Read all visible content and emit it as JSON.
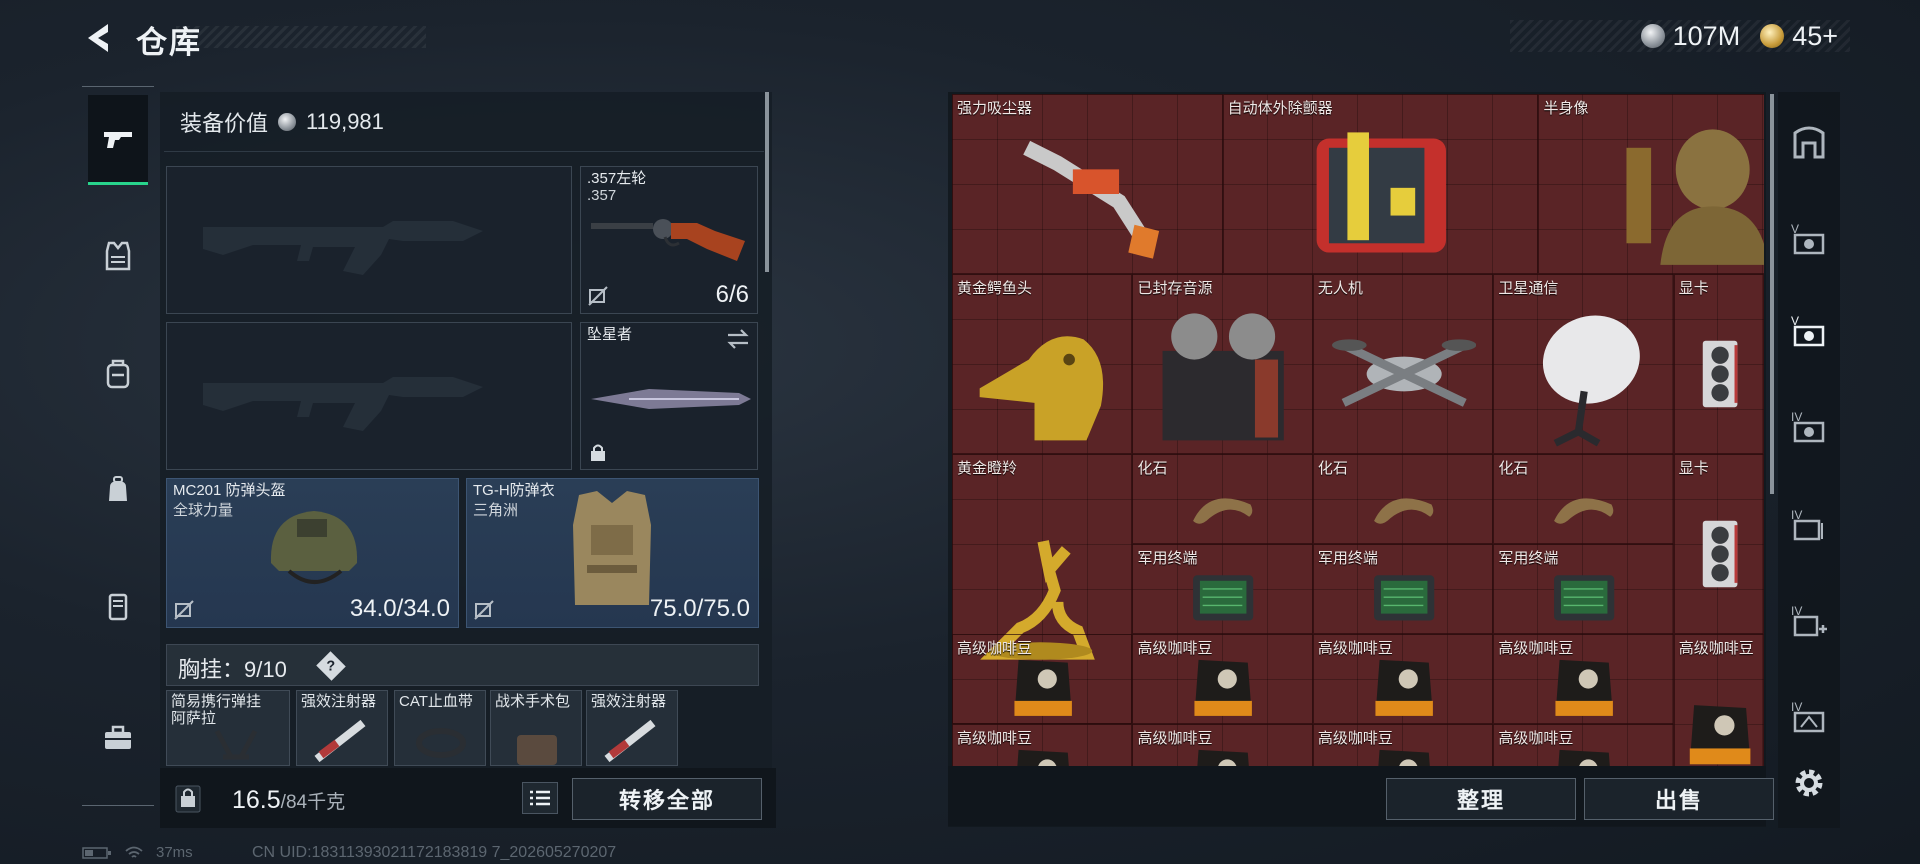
{
  "header": {
    "title": "仓库",
    "currencies": [
      {
        "icon": "silver-coin-icon",
        "value": "107M"
      },
      {
        "icon": "gold-coin-icon",
        "value": "45+"
      }
    ]
  },
  "left_rail": {
    "tabs": [
      {
        "icon": "gun-icon",
        "active": true
      },
      {
        "icon": "armor-vest-icon",
        "active": false
      },
      {
        "icon": "backpack-icon",
        "active": false
      },
      {
        "icon": "bag-icon",
        "active": false
      },
      {
        "icon": "container-icon",
        "active": false
      },
      {
        "icon": "toolbox-icon",
        "active": false
      }
    ]
  },
  "equipment": {
    "value_label": "装备价值",
    "value": "119,981",
    "sidearm": {
      "name": ".357左轮",
      "caliber": ".357",
      "ammo": "6/6"
    },
    "melee": {
      "name": "坠星者"
    },
    "helmet": {
      "name": "MC201 防弹头盔",
      "faction": "全球力量",
      "durability": "34.0/34.0"
    },
    "armor": {
      "name": "TG-H防弹衣",
      "faction": "三角洲",
      "durability": "75.0/75.0"
    },
    "chest_rig": {
      "label": "胸挂：",
      "capacity": "9/10",
      "help": "?"
    },
    "rig_items": [
      {
        "name": "简易携行弹挂",
        "sub": "阿萨拉"
      },
      {
        "name": "强效注射器",
        "sub": ""
      },
      {
        "name": "CAT止血带",
        "sub": ""
      },
      {
        "name": "战术手术包",
        "sub": ""
      },
      {
        "name": "强效注射器",
        "sub": ""
      }
    ]
  },
  "weight": {
    "current": "16.5",
    "max": "/84千克"
  },
  "buttons": {
    "transfer_all": "转移全部",
    "sort": "整理",
    "sell": "出售"
  },
  "status": {
    "ping": "37ms",
    "uid": "CN UID:18311393021172183819 7_202605270207"
  },
  "stash": {
    "items": [
      {
        "name": "强力吸尘器",
        "icon": "vacuum-icon"
      },
      {
        "name": "自动体外除颤器",
        "icon": "defibrillator-icon"
      },
      {
        "name": "半身像",
        "icon": "bust-icon"
      },
      {
        "name": "黄金鳄鱼头",
        "icon": "gold-croc-head-icon"
      },
      {
        "name": "已封存音源",
        "icon": "tape-recorder-icon"
      },
      {
        "name": "无人机",
        "icon": "drone-icon"
      },
      {
        "name": "卫星通信",
        "icon": "satellite-dish-icon"
      },
      {
        "name": "显卡",
        "icon": "gpu-icon"
      },
      {
        "name": "黄金瞪羚",
        "icon": "gold-gazelle-icon"
      },
      {
        "name": "化石",
        "icon": "fossil-icon"
      },
      {
        "name": "化石",
        "icon": "fossil-icon"
      },
      {
        "name": "化石",
        "icon": "fossil-icon"
      },
      {
        "name": "显卡",
        "icon": "gpu-icon"
      },
      {
        "name": "军用终端",
        "icon": "terminal-icon"
      },
      {
        "name": "军用终端",
        "icon": "terminal-icon"
      },
      {
        "name": "军用终端",
        "icon": "terminal-icon"
      },
      {
        "name": "高级咖啡豆",
        "icon": "coffee-bag-icon"
      },
      {
        "name": "高级咖啡豆",
        "icon": "coffee-bag-icon"
      },
      {
        "name": "高级咖啡豆",
        "icon": "coffee-bag-icon"
      },
      {
        "name": "高级咖啡豆",
        "icon": "coffee-bag-icon"
      },
      {
        "name": "高级咖啡豆",
        "icon": "coffee-bag-icon"
      },
      {
        "name": "高级咖啡豆",
        "icon": "coffee-bag-icon"
      },
      {
        "name": "高级咖啡豆",
        "icon": "coffee-bag-icon"
      },
      {
        "name": "高级咖啡豆",
        "icon": "coffee-bag-icon"
      },
      {
        "name": "高级咖啡豆",
        "icon": "coffee-bag-icon"
      }
    ]
  },
  "category_rail": {
    "tabs": [
      {
        "icon": "stash-home-icon"
      },
      {
        "icon": "stash-page-5-icon"
      },
      {
        "icon": "stash-page-6-icon"
      },
      {
        "icon": "stash-page-7-icon"
      },
      {
        "icon": "stash-page-8-icon"
      },
      {
        "icon": "stash-add-page-icon"
      },
      {
        "icon": "stash-page-9-icon"
      },
      {
        "icon": "settings-gear-icon"
      }
    ]
  },
  "colors": {
    "accent_green": "#28d48c",
    "stash_red": "#5a2426",
    "slot_blue": "#2a3e56"
  }
}
